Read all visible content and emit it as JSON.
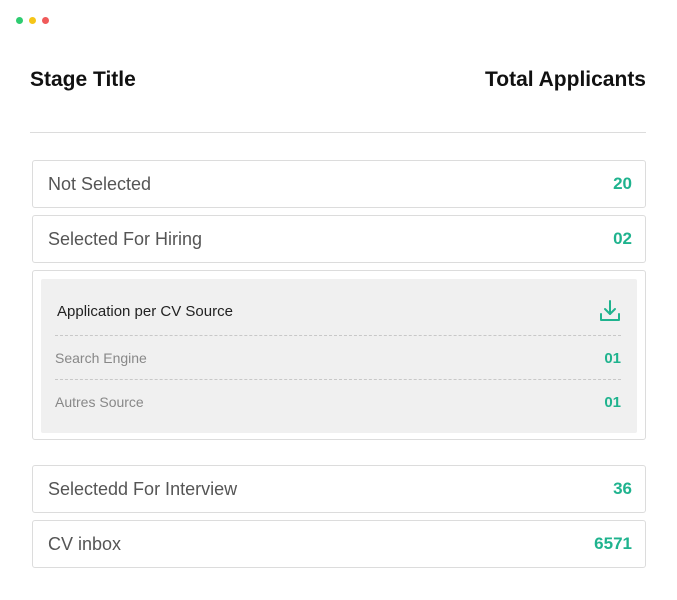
{
  "header": {
    "stage_title": "Stage Title",
    "total_applicants": "Total Applicants"
  },
  "stages": [
    {
      "label": "Not Selected",
      "value": "20"
    },
    {
      "label": "Selected For Hiring",
      "value": "02"
    },
    {
      "label": "Selectedd For Interview",
      "value": "36"
    },
    {
      "label": "CV inbox",
      "value": "6571"
    }
  ],
  "cv_source_panel": {
    "title": "Application per CV Source",
    "download_icon": "download-icon",
    "sources": [
      {
        "label": "Search Engine",
        "value": "01"
      },
      {
        "label": "Autres Source",
        "value": "01"
      }
    ]
  },
  "colors": {
    "accent": "#1fb38e",
    "border": "#dcdcdc",
    "panel_bg": "#f0f0f0",
    "window_dot_green": "#2ecc71",
    "window_dot_yellow": "#f5c518",
    "window_dot_red": "#f05a5a"
  }
}
